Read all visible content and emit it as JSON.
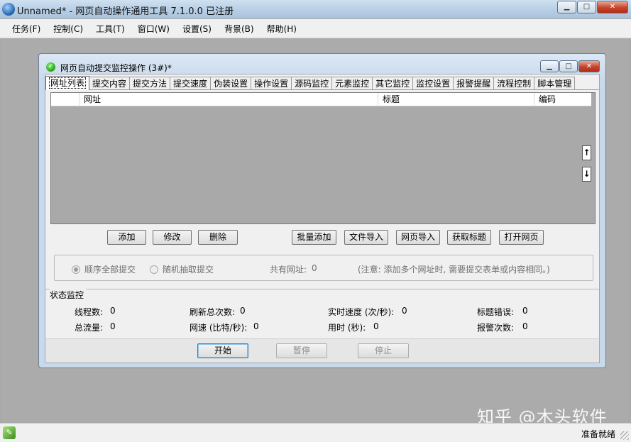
{
  "app": {
    "title": "Unnamed* - 网页自动操作通用工具 7.1.0.0  已注册"
  },
  "menu": [
    "任务(F)",
    "控制(C)",
    "工具(T)",
    "窗口(W)",
    "设置(S)",
    "背景(B)",
    "帮助(H)"
  ],
  "window_buttons": {
    "minimize": "▁",
    "maximize": "□",
    "close": "✕"
  },
  "child": {
    "title": "网页自动提交监控操作  (3#)*",
    "tabs": [
      "网址列表",
      "提交内容",
      "提交方法",
      "提交速度",
      "伪装设置",
      "操作设置",
      "源码监控",
      "元素监控",
      "其它监控",
      "监控设置",
      "报警提醒",
      "流程控制",
      "脚本管理"
    ],
    "active_tab": 0,
    "list_columns": [
      "",
      "网址",
      "标题",
      "编码"
    ],
    "sort_buttons": {
      "up": "↑",
      "down": "↓"
    },
    "buttons": {
      "add": "添加",
      "edit": "修改",
      "delete": "删除",
      "batch_add": "批量添加",
      "import_file": "文件导入",
      "import_web": "网页导入",
      "get_title": "获取标题",
      "open_page": "打开网页"
    },
    "options": {
      "sequential": "顺序全部提交",
      "random": "随机抽取提交",
      "selected": "sequential",
      "total_urls_label": "共有网址:",
      "total_urls": "0",
      "note": "(注意: 添加多个网址时, 需要提交表单或内容相同。)"
    },
    "status": {
      "label": "状态监控",
      "threads_label": "线程数:",
      "threads": "0",
      "refresh_label": "刷新总次数:",
      "refresh": "0",
      "speed_label": "实时速度 (次/秒):",
      "speed": "0",
      "title_errors_label": "标题错误:",
      "title_errors": "0",
      "traffic_label": "总流量:",
      "traffic": "0",
      "net_speed_label": "网速 (比特/秒):",
      "net_speed": "0",
      "elapsed_label": "用时 (秒):",
      "elapsed": "0",
      "alarms_label": "报警次数:",
      "alarms": "0"
    },
    "controls": {
      "start": "开始",
      "pause": "暂停",
      "stop": "停止"
    }
  },
  "watermark": "知乎 @木头软件",
  "statusbar": {
    "text": "准备就绪"
  }
}
